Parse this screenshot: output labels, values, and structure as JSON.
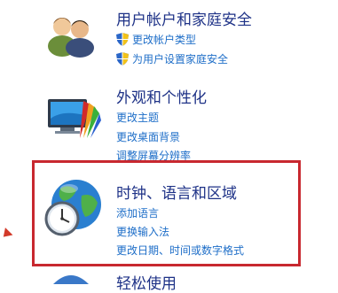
{
  "categories": {
    "user_accounts": {
      "title": "用户帐户和家庭安全",
      "links": [
        "更改帐户类型",
        "为用户设置家庭安全"
      ]
    },
    "appearance": {
      "title": "外观和个性化",
      "links": [
        "更改主题",
        "更改桌面背景",
        "调整屏幕分辨率"
      ]
    },
    "clock_region": {
      "title": "时钟、语言和区域",
      "links": [
        "添加语言",
        "更换输入法",
        "更改日期、时间或数字格式"
      ]
    },
    "ease_of_access": {
      "title": "轻松使用"
    }
  },
  "colors": {
    "title": "#1e3287",
    "link": "#1e6ec8",
    "highlight": "#c8282f"
  }
}
